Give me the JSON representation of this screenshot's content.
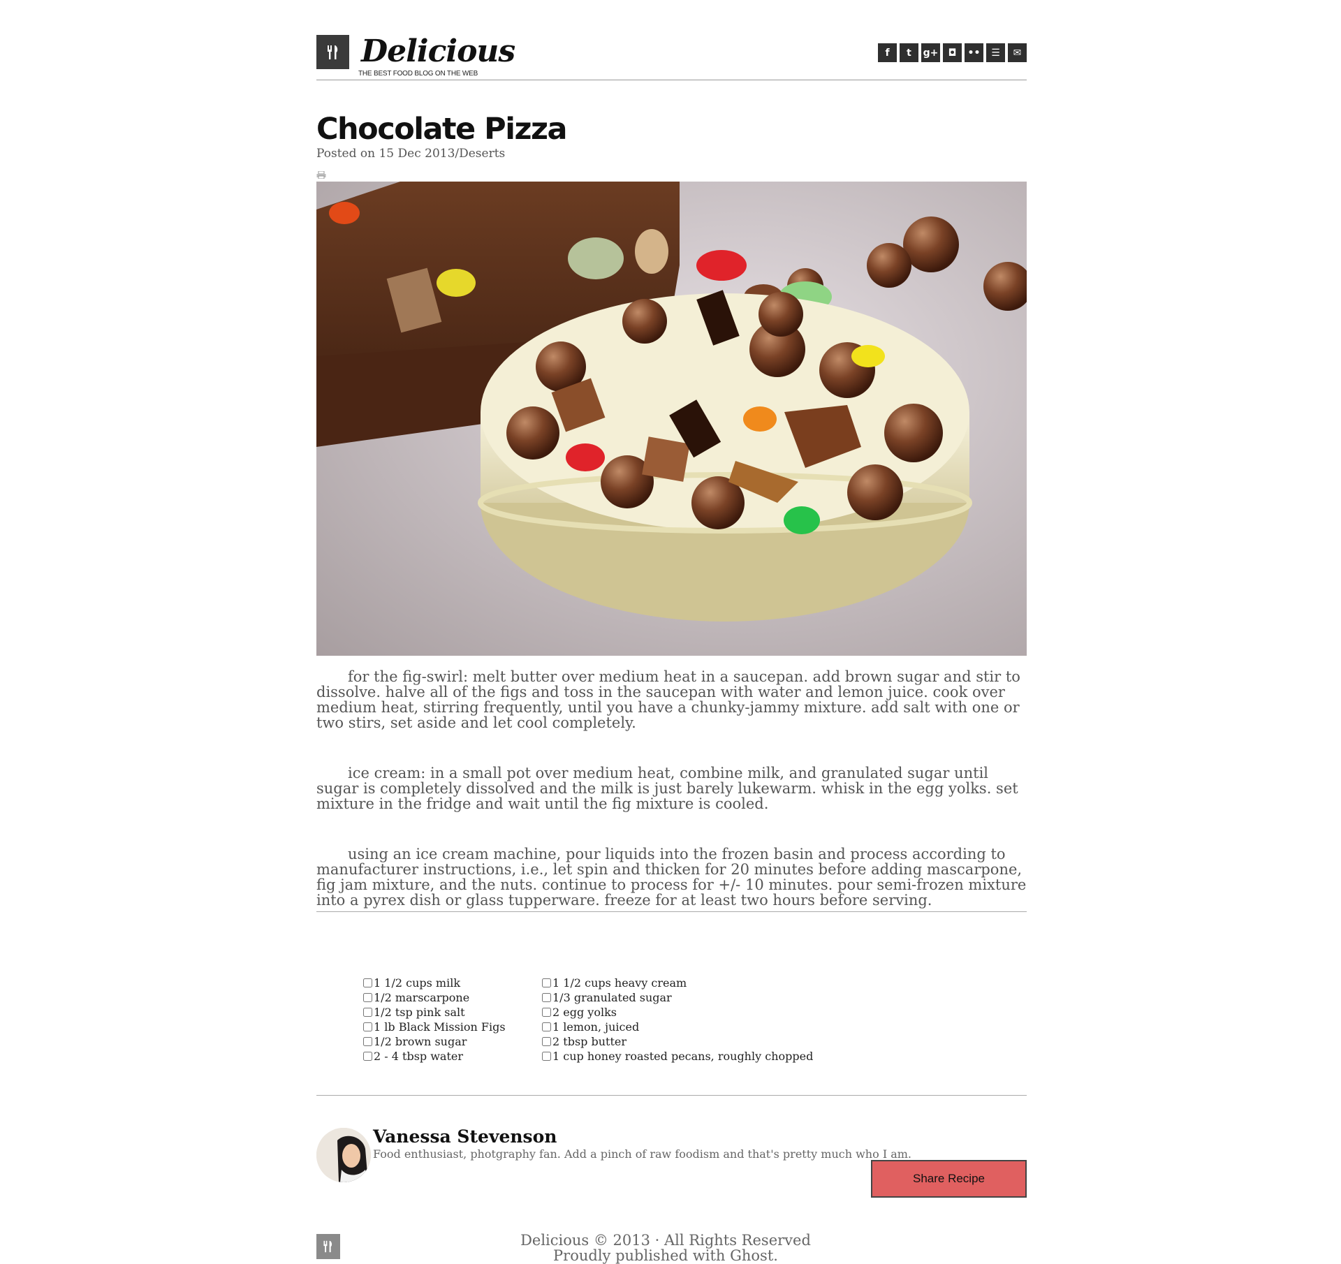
{
  "header": {
    "brand": "Delicious",
    "tagline": "THE BEST FOOD BLOG ON THE WEB",
    "social": [
      {
        "icon": "facebook-icon",
        "glyph": "f"
      },
      {
        "icon": "twitter-icon",
        "glyph": "t"
      },
      {
        "icon": "google-plus-icon",
        "glyph": "g+"
      },
      {
        "icon": "instagram-icon",
        "glyph": "◘"
      },
      {
        "icon": "flickr-icon",
        "glyph": "••"
      },
      {
        "icon": "rss-icon",
        "glyph": "☰"
      },
      {
        "icon": "email-icon",
        "glyph": "✉"
      }
    ]
  },
  "post": {
    "title": "Chocolate Pizza",
    "meta": "Posted on 15 Dec 2013/Deserts",
    "paragraphs": [
      "for the fig-swirl: melt butter over medium heat in a saucepan. add brown sugar and stir to dissolve. halve all of the figs and toss in the saucepan with water and lemon juice. cook over medium heat, stirring frequently, until you have a chunky-jammy mixture. add salt with one or two stirs, set aside and let cool completely.",
      "ice cream: in a small pot over medium heat, combine milk, and granulated sugar until sugar is completely dissolved and the milk is just barely lukewarm. whisk in the egg yolks. set mixture in the fridge and wait until the fig mixture is cooled.",
      "using an ice cream machine, pour liquids into the frozen basin and process according to manufacturer instructions, i.e., let spin and thicken for 20 minutes before adding mascarpone, fig jam mixture, and the nuts. continue to process for +/- 10 minutes. pour semi-frozen mixture into a pyrex dish or glass tupperware. freeze for at least two hours before serving."
    ]
  },
  "ingredients": {
    "left": [
      "1 1/2 cups milk",
      "1/2 marscarpone",
      "1/2 tsp pink salt",
      "1 lb Black Mission Figs",
      "1/2 brown sugar",
      "2 - 4 tbsp water"
    ],
    "right": [
      "1 1/2 cups heavy cream",
      "1/3 granulated sugar",
      "2 egg yolks",
      "1 lemon, juiced",
      "2 tbsp butter",
      "1 cup honey roasted pecans, roughly chopped"
    ]
  },
  "author": {
    "name": "Vanessa Stevenson",
    "bio": "Food enthusiast, photgraphy fan. Add a pinch of raw foodism and that's pretty much who I am."
  },
  "share_label": "Share Recipe",
  "footer": {
    "line1": "Delicious © 2013 · All Rights Reserved",
    "line2": "Proudly published with Ghost."
  }
}
